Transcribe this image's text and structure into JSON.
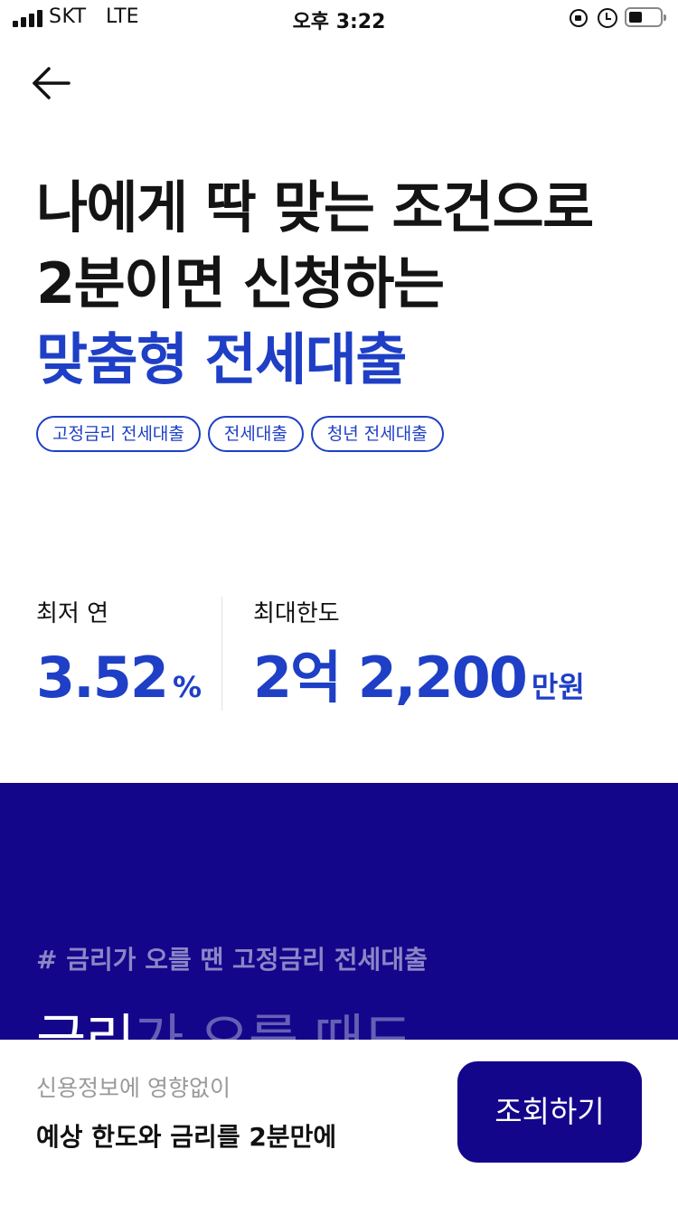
{
  "status_bar": {
    "carrier": "SKT",
    "network": "LTE",
    "time": "오후 3:22"
  },
  "icons": {
    "back": "arrow-left-icon",
    "signal": "signal-bars-icon",
    "rotation_lock": "rotation-lock-icon",
    "alarm": "alarm-clock-icon",
    "battery": "battery-icon"
  },
  "headline": {
    "line1": "나에게 딱 맞는 조건으로",
    "line2": "2분이면 신청하는",
    "line3": "맞춤형 전세대출"
  },
  "tags": [
    {
      "label": "고정금리 전세대출"
    },
    {
      "label": "전세대출"
    },
    {
      "label": "청년 전세대출"
    }
  ],
  "stats": {
    "rate": {
      "label": "최저 연",
      "value": "3.52",
      "unit": "%"
    },
    "limit": {
      "label": "최대한도",
      "value": "2억 2,200",
      "unit": "만원"
    }
  },
  "promo": {
    "tag": "# 금리가 오를 땐 고정금리 전세대출",
    "heading_bright": "금리",
    "heading_dim": "가 오를 때도"
  },
  "bottom_bar": {
    "subtitle": "신용정보에 영향없이",
    "title": "예상 한도와 금리를 2분만에",
    "cta_label": "조회하기"
  },
  "colors": {
    "accent_blue": "#1e3fc6",
    "navy": "#14068a",
    "text": "#111111",
    "muted": "#9a9a9a"
  }
}
